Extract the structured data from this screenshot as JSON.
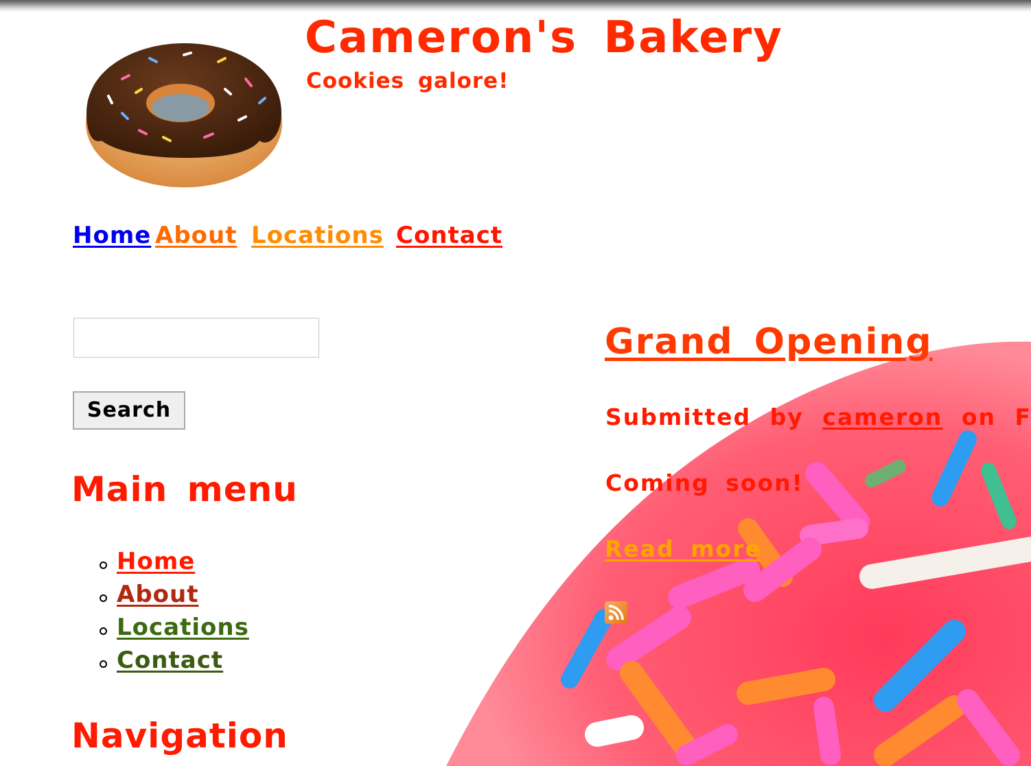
{
  "header": {
    "site_name": "Cameron's Bakery",
    "slogan": "Cookies galore!",
    "logo_icon": "donut-icon"
  },
  "primary_nav": [
    {
      "label": "Home",
      "color": "#0000ee"
    },
    {
      "label": "About",
      "color": "#ff6a00"
    },
    {
      "label": "Locations",
      "color": "#ff8c00"
    },
    {
      "label": "Contact",
      "color": "#ff1500"
    }
  ],
  "search": {
    "value": "",
    "button_label": "Search"
  },
  "sidebar": {
    "main_menu_title": "Main menu",
    "main_menu_items": [
      {
        "label": "Home"
      },
      {
        "label": "About"
      },
      {
        "label": "Locations"
      },
      {
        "label": "Contact"
      }
    ],
    "navigation_title": "Navigation"
  },
  "content": {
    "node_title": "Grand Opening",
    "submitted_prefix": "Submitted by",
    "author": "cameron",
    "submitted_suffix": "on Fri,",
    "body": "Coming soon!",
    "read_more": "Read more",
    "feed_icon": "rss-icon"
  },
  "colors": {
    "brand_red": "#ff2a00",
    "read_more_orange": "#ffa500"
  }
}
